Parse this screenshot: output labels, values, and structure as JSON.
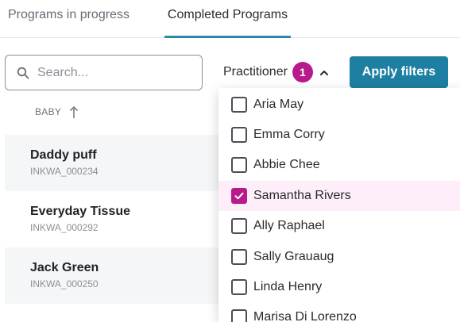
{
  "tabs": [
    {
      "label": "Programs in progress",
      "active": false
    },
    {
      "label": "Completed Programs",
      "active": true
    }
  ],
  "search": {
    "placeholder": "Search...",
    "value": ""
  },
  "practitioner_filter": {
    "label": "Practitioner",
    "count": "1",
    "expanded": true
  },
  "apply_button": {
    "label": "Apply filters"
  },
  "table": {
    "column_header": "BABY",
    "sort": "ascending",
    "rows": [
      {
        "name": "Daddy puff",
        "code": "INKWA_000234"
      },
      {
        "name": "Everyday Tissue",
        "code": "INKWA_000292"
      },
      {
        "name": "Jack Green",
        "code": "INKWA_000250"
      }
    ]
  },
  "practitioner_options": [
    {
      "label": "Aria May",
      "checked": false
    },
    {
      "label": "Emma Corry",
      "checked": false
    },
    {
      "label": "Abbie Chee",
      "checked": false
    },
    {
      "label": "Samantha Rivers",
      "checked": true
    },
    {
      "label": "Ally Raphael",
      "checked": false
    },
    {
      "label": "Sally Grauaug",
      "checked": false
    },
    {
      "label": "Linda Henry",
      "checked": false
    },
    {
      "label": "Marisa Di Lorenzo",
      "checked": false
    }
  ],
  "colors": {
    "accent": "#1d7fa1",
    "tab_underline": "#2a8aa8",
    "badge": "#b81a8c",
    "checkbox_checked": "#b81a8c",
    "selected_row_bg": "#fdeefa",
    "row_shade": "#f5f6f8"
  },
  "icons": {
    "search": "search-icon",
    "chevron": "chevron-up-icon",
    "sort": "arrow-up-icon",
    "check": "check-icon"
  }
}
